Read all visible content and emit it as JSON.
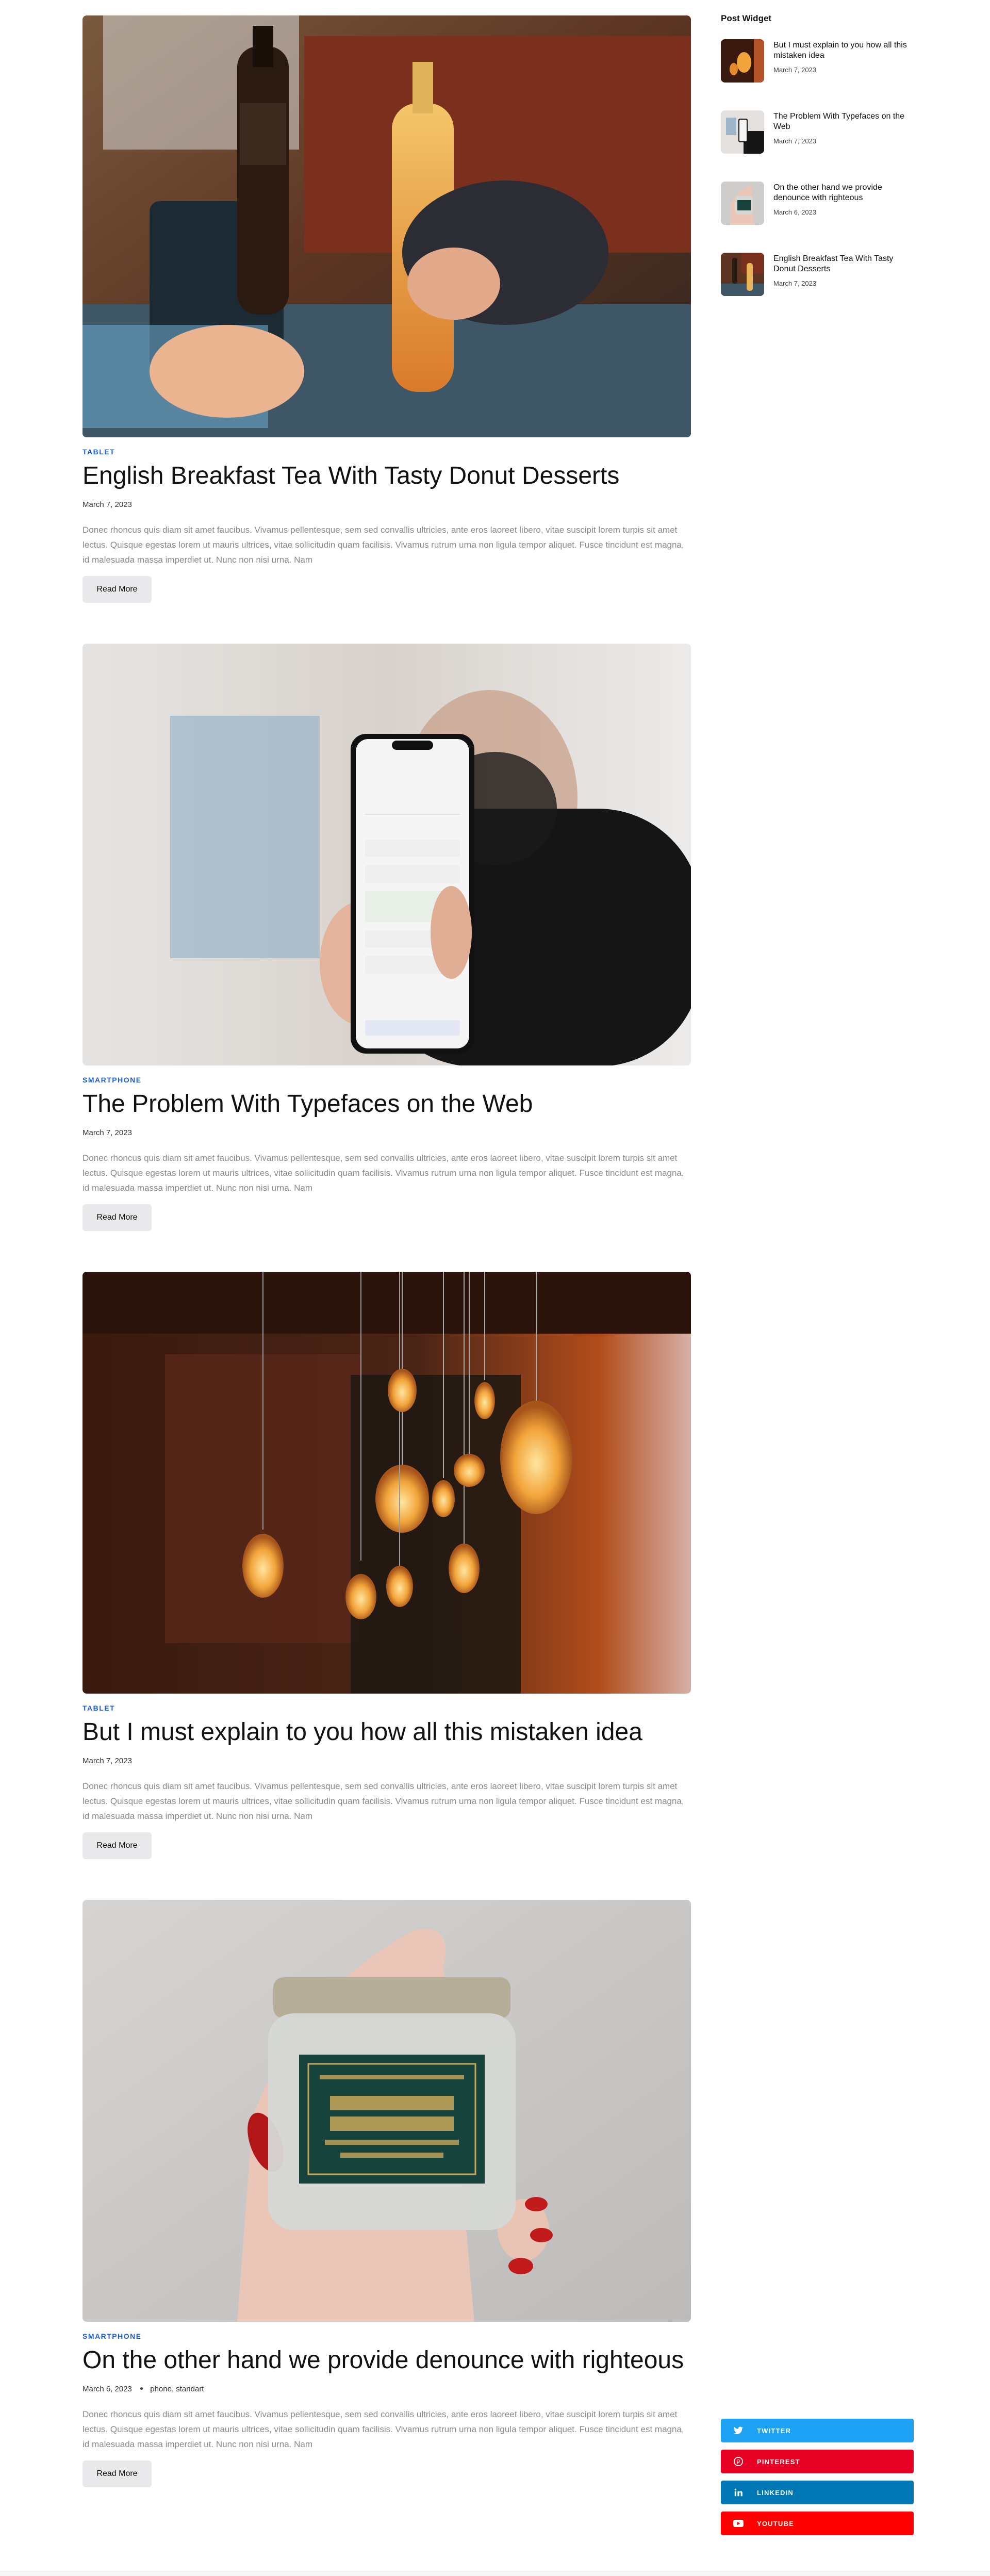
{
  "posts": [
    {
      "category": "TABLET",
      "title": "English Breakfast Tea With Tasty Donut Desserts",
      "date": "March 7, 2023",
      "tags": "",
      "excerpt": "Donec rhoncus quis diam sit amet faucibus. Vivamus pellentesque, sem sed convallis ultricies, ante eros laoreet libero, vitae suscipit lorem turpis sit amet lectus. Quisque egestas lorem ut mauris ultrices, vitae sollicitudin quam facilisis. Vivamus rutrum urna non ligula tempor aliquet. Fusce tincidunt est magna, id malesuada massa imperdiet ut. Nunc non nisi urna. Nam",
      "button": "Read More"
    },
    {
      "category": "SMARTPHONE",
      "title": "The Problem With Typefaces on the Web",
      "date": "March 7, 2023",
      "tags": "",
      "excerpt": "Donec rhoncus quis diam sit amet faucibus. Vivamus pellentesque, sem sed convallis ultricies, ante eros laoreet libero, vitae suscipit lorem turpis sit amet lectus. Quisque egestas lorem ut mauris ultrices, vitae sollicitudin quam facilisis. Vivamus rutrum urna non ligula tempor aliquet. Fusce tincidunt est magna, id malesuada massa imperdiet ut. Nunc non nisi urna. Nam",
      "button": "Read More"
    },
    {
      "category": "TABLET",
      "title": "But I must explain to you how all this mistaken idea",
      "date": "March 7, 2023",
      "tags": "",
      "excerpt": "Donec rhoncus quis diam sit amet faucibus. Vivamus pellentesque, sem sed convallis ultricies, ante eros laoreet libero, vitae suscipit lorem turpis sit amet lectus. Quisque egestas lorem ut mauris ultrices, vitae sollicitudin quam facilisis. Vivamus rutrum urna non ligula tempor aliquet. Fusce tincidunt est magna, id malesuada massa imperdiet ut. Nunc non nisi urna. Nam",
      "button": "Read More"
    },
    {
      "category": "SMARTPHONE",
      "title": "On the other hand we provide denounce with righteous",
      "date": "March 6, 2023",
      "tags": "phone, standart",
      "excerpt": "Donec rhoncus quis diam sit amet faucibus. Vivamus pellentesque, sem sed convallis ultricies, ante eros laoreet libero, vitae suscipit lorem turpis sit amet lectus. Quisque egestas lorem ut mauris ultrices, vitae sollicitudin quam facilisis. Vivamus rutrum urna non ligula tempor aliquet. Fusce tincidunt est magna, id malesuada massa imperdiet ut. Nunc non nisi urna. Nam",
      "button": "Read More"
    }
  ],
  "sidebar": {
    "widget_title": "Post Widget",
    "items": [
      {
        "title": "But I must explain to you how all this mistaken idea",
        "date": "March 7, 2023"
      },
      {
        "title": "The Problem With Typefaces on the Web",
        "date": "March 7, 2023"
      },
      {
        "title": "On the other hand we provide denounce with righteous",
        "date": "March 6, 2023"
      },
      {
        "title": "English Breakfast Tea With Tasty Donut Desserts",
        "date": "March 7, 2023"
      }
    ],
    "social": [
      {
        "label": "TWITTER",
        "icon": "twitter-icon",
        "color": "#1da1f2"
      },
      {
        "label": "PINTEREST",
        "icon": "pinterest-icon",
        "color": "#e60023"
      },
      {
        "label": "LINKEDIN",
        "icon": "linkedin-icon",
        "color": "#0077b5"
      },
      {
        "label": "YOUTUBE",
        "icon": "youtube-icon",
        "color": "#ff0000"
      }
    ]
  },
  "colors": {
    "accent": "#1d5fd1",
    "button_bg": "#e9e9ec",
    "excerpt_text": "#8a8a8a"
  }
}
